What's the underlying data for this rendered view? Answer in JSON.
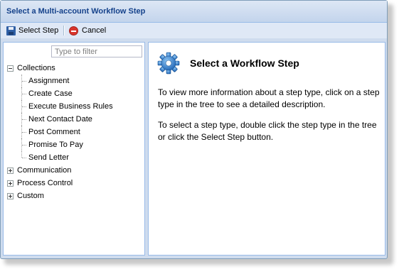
{
  "window": {
    "title": "Select a Multi-account Workflow Step"
  },
  "toolbar": {
    "select_label": "Select Step",
    "cancel_label": "Cancel"
  },
  "filter": {
    "placeholder": "Type to filter",
    "value": ""
  },
  "tree": {
    "collections": {
      "label": "Collections",
      "expanded": true,
      "children": [
        "Assignment",
        "Create Case",
        "Execute Business Rules",
        "Next Contact Date",
        "Post Comment",
        "Promise To Pay",
        "Send Letter"
      ]
    },
    "communication": {
      "label": "Communication",
      "expanded": false
    },
    "process_control": {
      "label": "Process Control",
      "expanded": false
    },
    "custom": {
      "label": "Custom",
      "expanded": false
    }
  },
  "detail": {
    "title": "Select a Workflow Step",
    "paragraph1": "To view more information about a step type, click on a step type in the tree to see a detailed description.",
    "paragraph2": "To select a step type, double click the step type in the tree or click the Select Step button."
  },
  "colors": {
    "title_text": "#15428b",
    "panel_border": "#99bbe8",
    "window_bg": "#cfdcee",
    "icon_blue": "#2f7fd0"
  },
  "icons": {
    "select_step": "floppy-disk-icon",
    "cancel": "cancel-icon",
    "workflow": "gear-icon"
  }
}
